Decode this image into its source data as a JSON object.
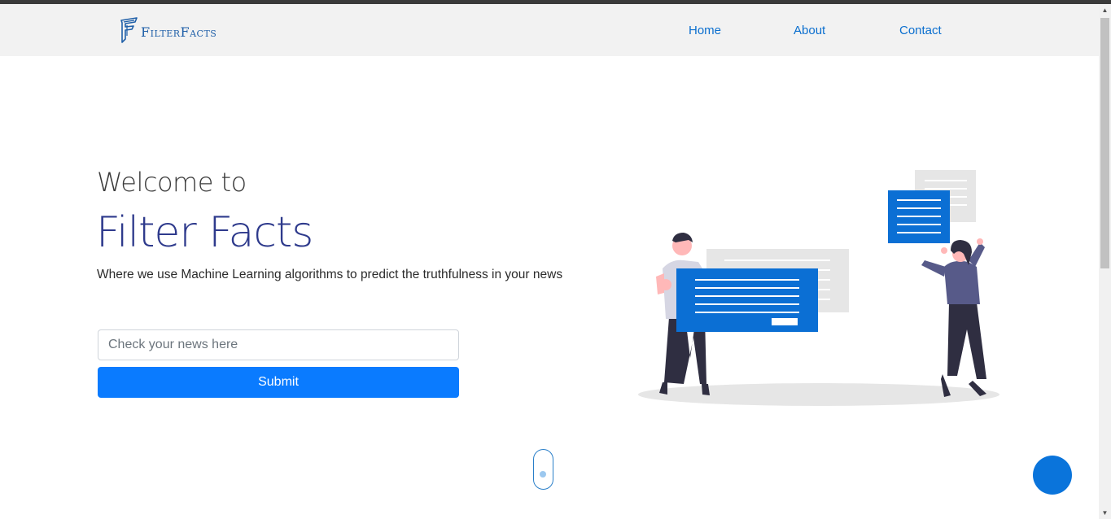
{
  "brand": {
    "logo_text": "FilterFacts",
    "logo_icon": "filterfacts-logo-icon"
  },
  "nav": {
    "items": [
      {
        "label": "Home"
      },
      {
        "label": "About"
      },
      {
        "label": "Contact"
      }
    ]
  },
  "hero": {
    "welcome": "Welcome to",
    "title": "Filter Facts",
    "tagline": "Where we use Machine Learning algorithms to predict the truthfulness in your news",
    "input_placeholder": "Check your news here",
    "input_value": "",
    "submit_label": "Submit",
    "illustration": "two-people-holding-documents-illustration"
  },
  "icons": {
    "scroll_indicator": "mouse-scroll-icon",
    "chat_fab": "chat-bubble-icon"
  },
  "colors": {
    "accent": "#0a7bff",
    "title": "#2e3a8c",
    "nav_link": "#0b6fcf",
    "navbar_bg": "#f2f2f2",
    "illustration_blue": "#0b6fd4"
  }
}
